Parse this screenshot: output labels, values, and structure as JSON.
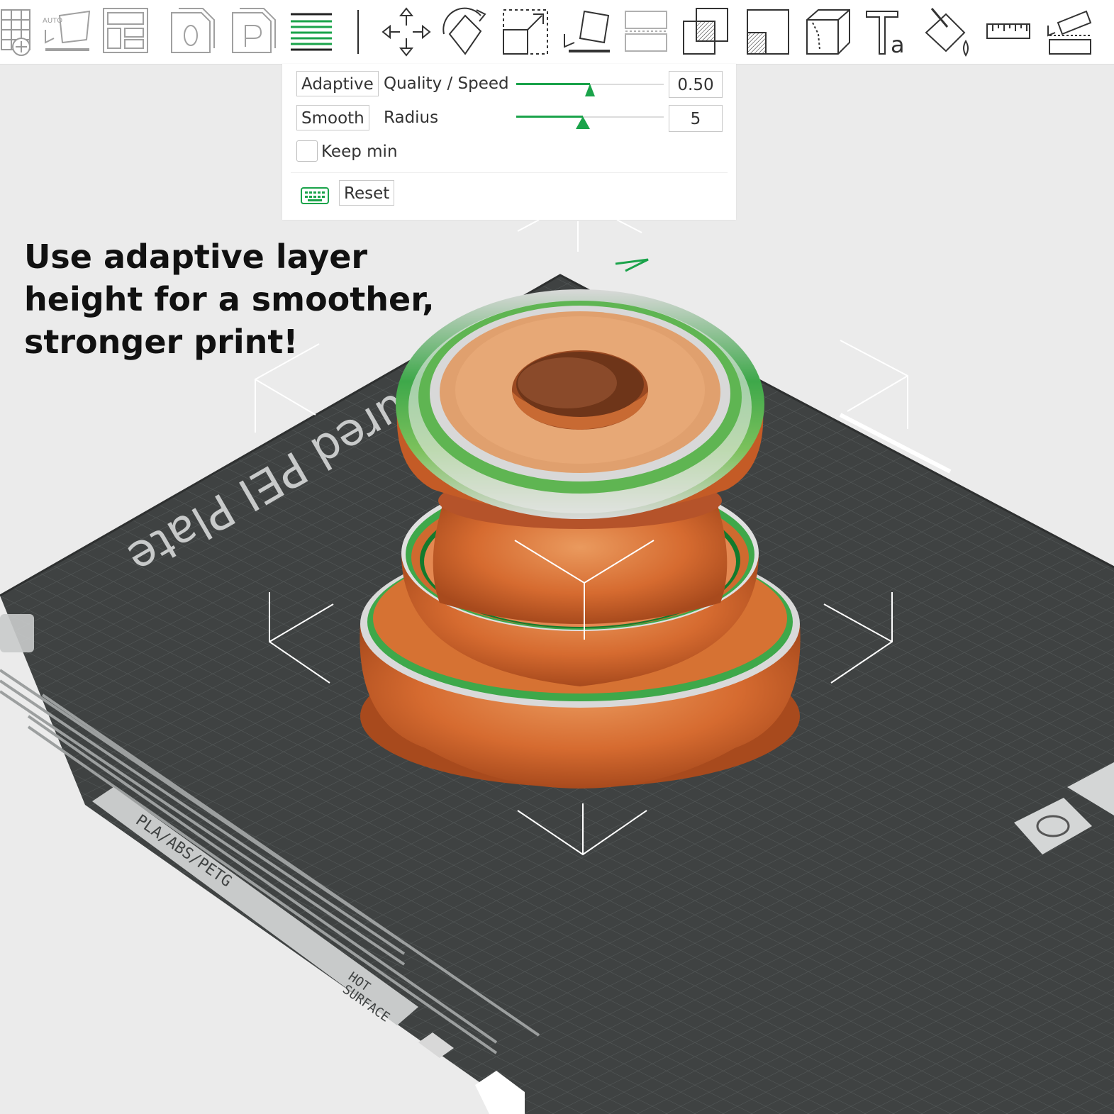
{
  "toolbar": {
    "icons": [
      "add-plate-grid-icon",
      "auto-orient-icon",
      "arrange-icon",
      "plate-o-icon",
      "plate-p-icon",
      "variable-layer-height-icon",
      "move-icon",
      "rotate-icon",
      "scale-icon",
      "lay-on-face-icon",
      "split-icon",
      "cut-icon",
      "mesh-boolean-icon",
      "cube-icon",
      "text-icon",
      "paint-bucket-icon",
      "measure-icon",
      "assembly-icon"
    ],
    "auto_label": "AUTO"
  },
  "panel": {
    "adaptive_label": "Adaptive",
    "quality_speed_label": "Quality / Speed",
    "quality_value": "0.50",
    "quality_fraction": 0.5,
    "smooth_label": "Smooth",
    "radius_label": "Radius",
    "radius_value": "5",
    "radius_fraction": 0.45,
    "keep_min_label": "Keep min",
    "keep_min_checked": false,
    "reset_label": "Reset",
    "keyboard_icon": "keyboard-icon"
  },
  "caption": {
    "line1": "Use adaptive layer",
    "line2": "height for a smoother,",
    "line3": "stronger print!"
  },
  "plate": {
    "name": "Textured PEI Plate",
    "name_visible": "ured PEI Plate",
    "material_text": "PLA/ABS/PETG",
    "warning_line1": "HOT",
    "warning_line2": "SURFACE"
  },
  "colors": {
    "accent": "#1aa34a",
    "model_orange": "#d4692f",
    "plate": "#3f4242",
    "background": "#ebebeb"
  }
}
